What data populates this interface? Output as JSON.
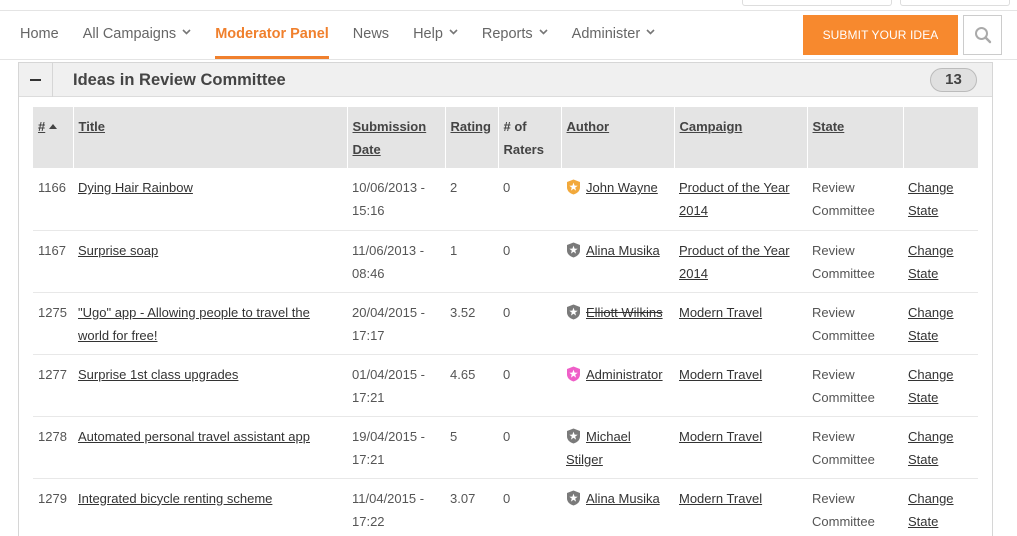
{
  "nav": {
    "items": [
      {
        "label": "Home",
        "dropdown": false,
        "active": false
      },
      {
        "label": "All Campaigns",
        "dropdown": true,
        "active": false
      },
      {
        "label": "Moderator Panel",
        "dropdown": false,
        "active": true
      },
      {
        "label": "News",
        "dropdown": false,
        "active": false
      },
      {
        "label": "Help",
        "dropdown": true,
        "active": false
      },
      {
        "label": "Reports",
        "dropdown": true,
        "active": false
      },
      {
        "label": "Administer",
        "dropdown": true,
        "active": false
      }
    ],
    "submit_label": "SUBMIT YOUR IDEA",
    "accent_color": "#f7892e"
  },
  "panel": {
    "title": "Ideas in Review Committee",
    "count": "13"
  },
  "table": {
    "headers": {
      "num": "#",
      "title": "Title",
      "submission_date": "Submission Date",
      "rating": "Rating",
      "raters": "# of Raters",
      "author": "Author",
      "campaign": "Campaign",
      "state": "State"
    },
    "rows": [
      {
        "num": "1166",
        "title": "Dying Hair Rainbow",
        "date": "10/06/2013 - 15:16",
        "rating": "2",
        "raters": "0",
        "author": "John Wayne",
        "author_badge": "gold",
        "author_struck": false,
        "campaign": "Product of the Year 2014",
        "state": "Review Committee",
        "action": "Change State"
      },
      {
        "num": "1167",
        "title": "Surprise soap",
        "date": "11/06/2013 - 08:46",
        "rating": "1",
        "raters": "0",
        "author": "Alina Musika",
        "author_badge": "gray",
        "author_struck": false,
        "campaign": "Product of the Year 2014",
        "state": "Review Committee",
        "action": "Change State"
      },
      {
        "num": "1275",
        "title": "\"Ugo\" app - Allowing people to travel the world for free!",
        "date": "20/04/2015 - 17:17",
        "rating": "3.52",
        "raters": "0",
        "author": "Elliott Wilkins",
        "author_badge": "gray",
        "author_struck": true,
        "campaign": "Modern Travel",
        "state": "Review Committee",
        "action": "Change State"
      },
      {
        "num": "1277",
        "title": "Surprise 1st class upgrades",
        "date": "01/04/2015 - 17:21",
        "rating": "4.65",
        "raters": "0",
        "author": "Administrator",
        "author_badge": "pink",
        "author_struck": false,
        "campaign": "Modern Travel",
        "state": "Review Committee",
        "action": "Change State"
      },
      {
        "num": "1278",
        "title": "Automated personal travel assistant app",
        "date": "19/04/2015 - 17:21",
        "rating": "5",
        "raters": "0",
        "author": "Michael Stilger",
        "author_badge": "gray",
        "author_struck": false,
        "campaign": "Modern Travel",
        "state": "Review Committee",
        "action": "Change State"
      },
      {
        "num": "1279",
        "title": "Integrated bicycle renting scheme",
        "date": "11/04/2015 - 17:22",
        "rating": "3.07",
        "raters": "0",
        "author": "Alina Musika",
        "author_badge": "gray",
        "author_struck": false,
        "campaign": "Modern Travel",
        "state": "Review Committee",
        "action": "Change State"
      }
    ]
  },
  "badge_colors": {
    "gold": "#f2a93b",
    "gray": "#7a7a7a",
    "pink": "#ef5fc8"
  }
}
